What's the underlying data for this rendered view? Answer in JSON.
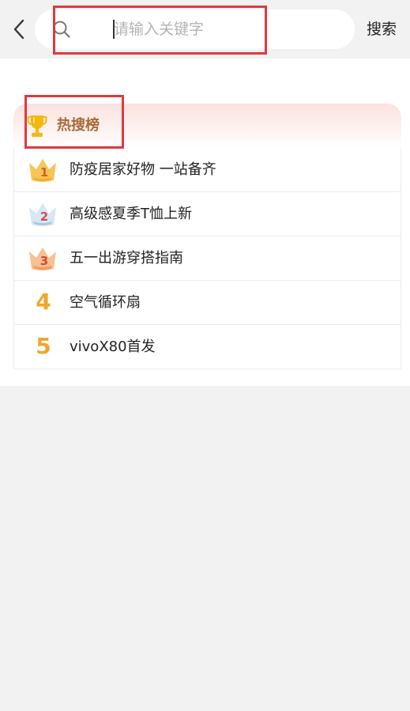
{
  "search": {
    "placeholder": "请输入关键字",
    "value": "",
    "button_label": "搜索"
  },
  "hot_list": {
    "title": "热搜榜",
    "items": [
      {
        "rank": "1",
        "label": "防疫居家好物 一站备齐",
        "badge": "crown-gold"
      },
      {
        "rank": "2",
        "label": "高级感夏季T恤上新",
        "badge": "crown-silver"
      },
      {
        "rank": "3",
        "label": "五一出游穿搭指南",
        "badge": "crown-bronze"
      },
      {
        "rank": "4",
        "label": "空气循环扇",
        "badge": "number"
      },
      {
        "rank": "5",
        "label": "vivoX80首发",
        "badge": "number"
      }
    ]
  },
  "colors": {
    "highlight_box": "#e0393f",
    "header_title": "#a86a3a",
    "rank_number": "#f0a531",
    "crown_gold": "#f6c65a",
    "crown_silver": "#c9dff0",
    "crown_bronze": "#f5b07a"
  },
  "icons": {
    "back": "chevron-left-icon",
    "search": "magnifier-icon",
    "trophy": "trophy-icon"
  }
}
